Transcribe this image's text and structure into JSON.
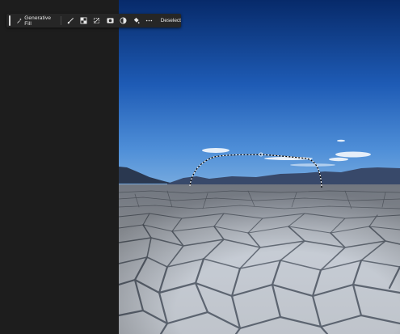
{
  "taskbar": {
    "generative_fill_label": "Generative Fill",
    "deselect_label": "Deselect",
    "tools": [
      {
        "icon": "brush-selection-icon"
      },
      {
        "icon": "select-subject-icon"
      },
      {
        "icon": "transform-selection-icon"
      },
      {
        "icon": "create-mask-icon"
      },
      {
        "icon": "adjustment-layer-icon"
      },
      {
        "icon": "fill-selection-icon"
      },
      {
        "icon": "more-options-icon"
      }
    ]
  },
  "colors": {
    "app_background": "#1e1e1e",
    "taskbar_background": "#262626",
    "taskbar_text": "#eaeaea",
    "sky_top": "#072a6a",
    "sky_bottom": "#6aa2dd",
    "salt_flat": "#c9cfd8"
  }
}
